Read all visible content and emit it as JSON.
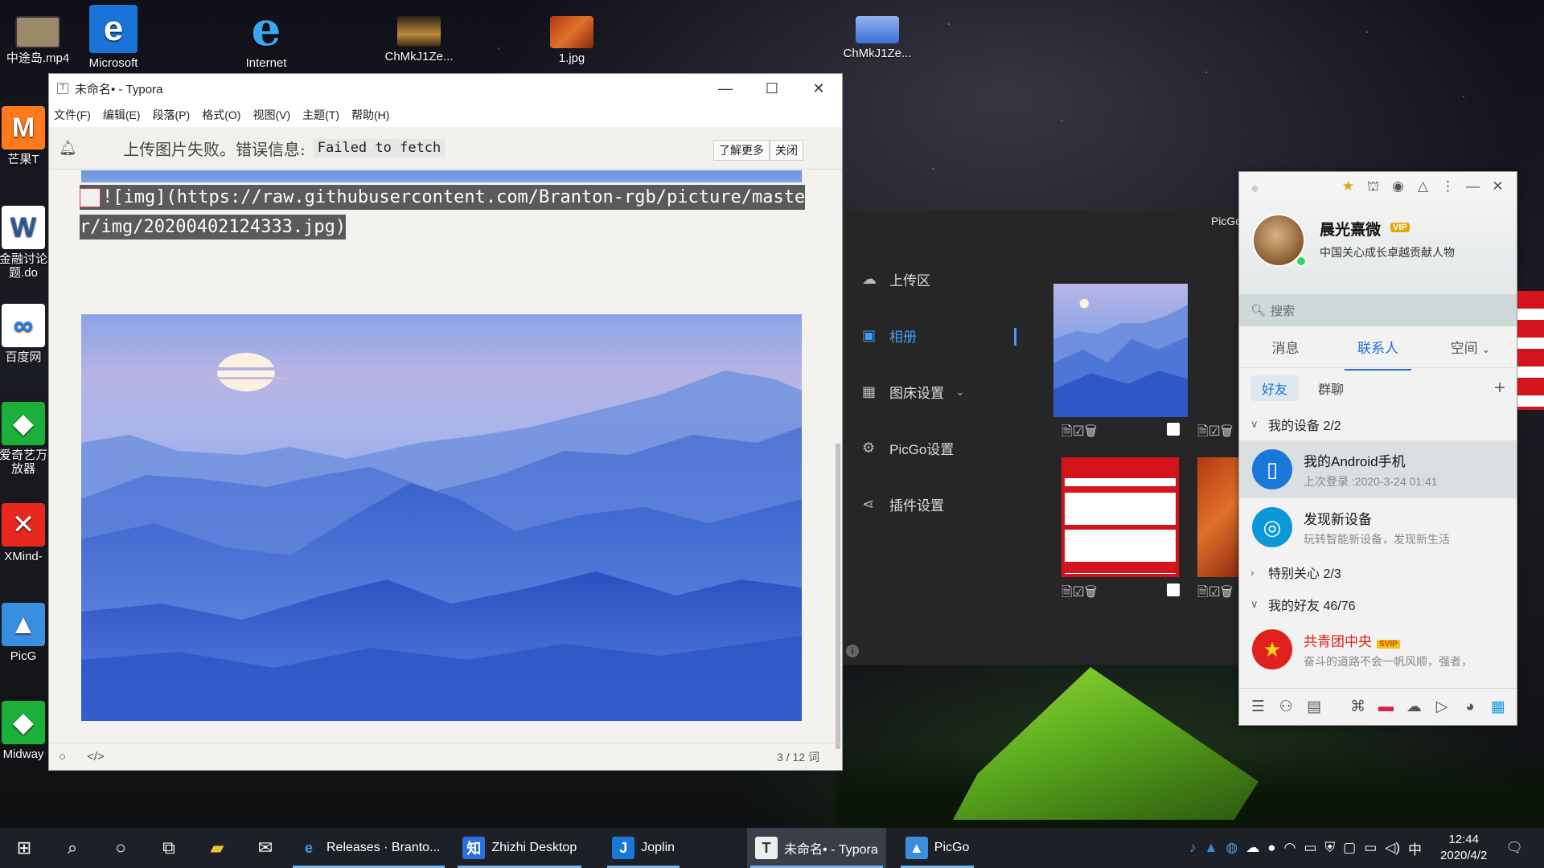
{
  "desktop": {
    "icons_top": [
      {
        "label": "中途岛.mp4"
      },
      {
        "label": "Microsoft"
      },
      {
        "label": "Internet"
      },
      {
        "label": "ChMkJ1Ze..."
      },
      {
        "label": "1.jpg"
      },
      {
        "label": "ChMkJ1Ze..."
      }
    ],
    "icons_left": [
      {
        "label": "芒果T"
      },
      {
        "label": "金融讨论题.do"
      },
      {
        "label": "百度网"
      },
      {
        "label": "爱奇艺万放器"
      },
      {
        "label": "XMind-"
      },
      {
        "label": "PicG"
      },
      {
        "label": "Midway"
      }
    ]
  },
  "typora": {
    "title": "未命名• - Typora",
    "window_controls": [
      "—",
      "☐",
      "✕"
    ],
    "menu": [
      "文件(F)",
      "编辑(E)",
      "段落(P)",
      "格式(O)",
      "视图(V)",
      "主题(T)",
      "帮助(H)"
    ],
    "notice": {
      "message": "上传图片失败。错误信息:",
      "error": "Failed to fetch",
      "learn_more": "了解更多",
      "close": "关闭"
    },
    "markdown_source": "![img](https://raw.githubusercontent.com/Branton-rgb/picture/master/img/20200402124333.jpg)",
    "word_count": "3 / 12 词"
  },
  "picgo": {
    "title": "PicGo",
    "nav": [
      {
        "label": "上传区",
        "icon": "cloud-upload-icon"
      },
      {
        "label": "相册",
        "icon": "image-icon",
        "active": true
      },
      {
        "label": "图床设置",
        "icon": "grid-icon"
      },
      {
        "label": "PicGo设置",
        "icon": "gear-icon"
      },
      {
        "label": "插件设置",
        "icon": "share-icon"
      }
    ]
  },
  "qq": {
    "name": "晨光熹微",
    "vip": "VIP",
    "signature": "中国关心成长卓越贡献人物",
    "search_placeholder": "搜索",
    "tabs": [
      "消息",
      "联系人",
      "空间"
    ],
    "subtabs": [
      "好友",
      "群聊"
    ],
    "groups": {
      "devices": "我的设备 2/2",
      "special": "特别关心 2/3",
      "friends": "我的好友 46/76"
    },
    "items": [
      {
        "title": "我的Android手机",
        "subtitle": "上次登录 :2020-3-24 01:41"
      },
      {
        "title": "发现新设备",
        "subtitle": "玩转智能新设备，发现新生活"
      },
      {
        "title": "共青团中央",
        "badge": "SVIP",
        "subtitle": "奋斗的道路不会一帆风顺，强者，"
      }
    ]
  },
  "taskbar": {
    "apps": [
      {
        "label": "Releases · Branto..."
      },
      {
        "label": "Zhizhi Desktop"
      },
      {
        "label": "Joplin"
      },
      {
        "label": "未命名• - Typora"
      },
      {
        "label": "PicGo"
      }
    ],
    "ime": "中",
    "time": "12:44",
    "date": "2020/4/2"
  },
  "colors": {
    "accent": "#409eff",
    "qq_accent": "#1e6fd0",
    "taskbar": "#1d2127"
  }
}
